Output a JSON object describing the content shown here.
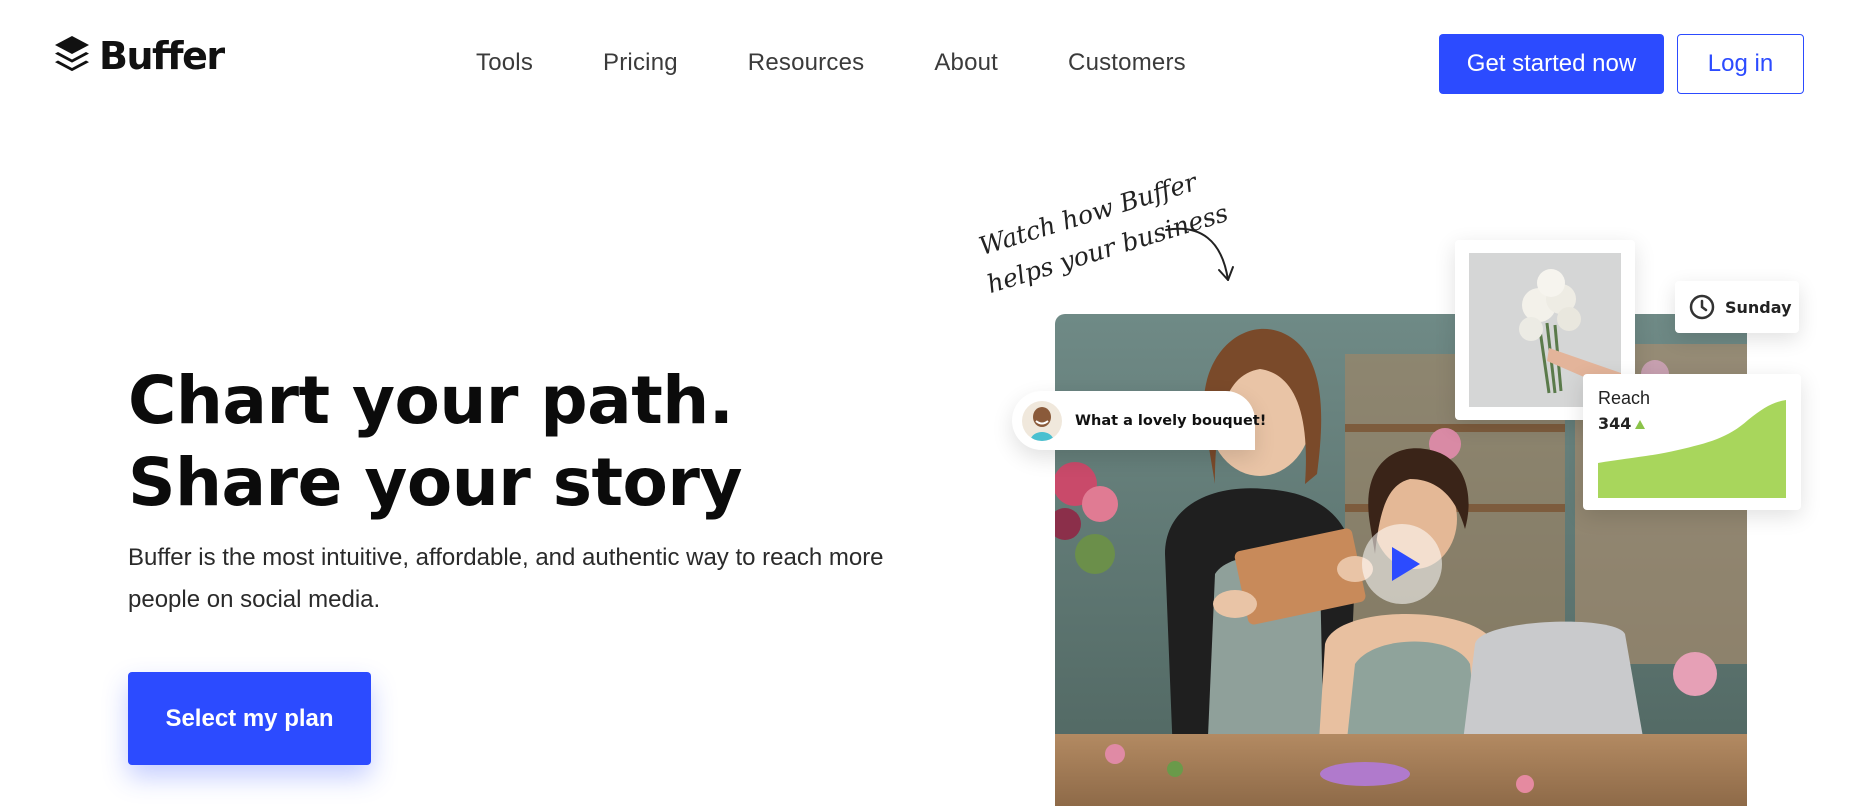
{
  "brand": {
    "name": "Buffer",
    "accent": "#2c4bff",
    "chart_green": "#a8d65c"
  },
  "nav": [
    {
      "label": "Tools"
    },
    {
      "label": "Pricing"
    },
    {
      "label": "Resources"
    },
    {
      "label": "About"
    },
    {
      "label": "Customers"
    }
  ],
  "header": {
    "primary_cta": "Get started now",
    "login": "Log in"
  },
  "hero": {
    "title_line1": "Chart your path.",
    "title_line2": "Share your story",
    "subtitle": "Buffer is the most intuitive, affordable, and authentic way to reach more people on social media.",
    "cta": "Select my plan"
  },
  "media": {
    "handwritten_line1": "Watch how Buffer",
    "handwritten_line2": "helps your business",
    "comment": "What a lovely bouquet!",
    "schedule_day": "Sunday",
    "stat_label": "Reach",
    "stat_value": "344",
    "icons": [
      "buffer-logo-icon",
      "arrow-icon",
      "play-icon",
      "clock-icon",
      "trend-up-icon"
    ]
  }
}
